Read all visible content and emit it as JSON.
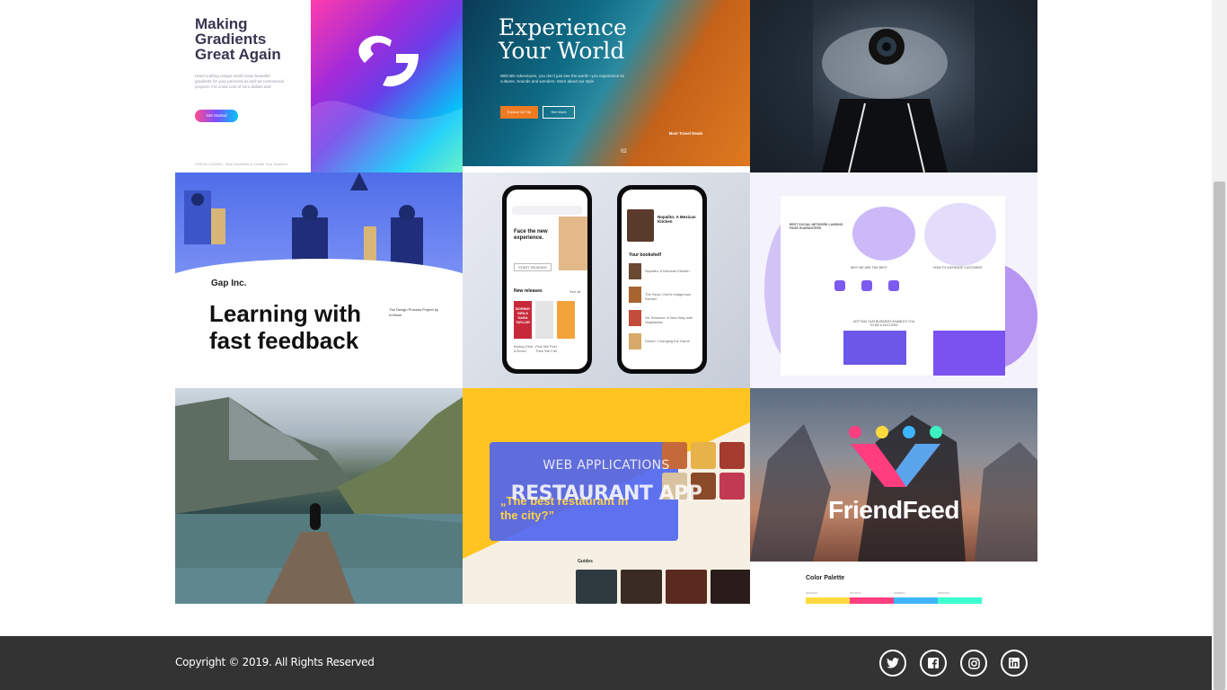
{
  "gallery": {
    "tiles": [
      {
        "title": "Making Gradients Great Again",
        "body": "Hand crafting unique world-class beautiful gradients for your personal as well as commercial projects. For a low cost of zero dollars and",
        "button": "Get Started",
        "footer": "SCROLL DOWN  ↓   New Gradients & Create Your Gradient"
      },
      {
        "title_line1": "Experience",
        "title_line2": "Your World",
        "body": "With BD Adventures, you don't just see the world—you experience its cultures. Sounds and wonders. More about our style",
        "button_primary": "Explore All Trip",
        "button_secondary": "See More",
        "deals_label": "Best Travel Deals",
        "slide_counter": "02"
      },
      {},
      {
        "brand": "Gap Inc.",
        "headline": "Learning with fast feedback",
        "project_label": "The Design Process Project by InVision"
      },
      {
        "left_heading": "Face the new experience.",
        "left_button": "START READING",
        "left_section": "New releases",
        "left_see_all": "See all",
        "book_cover": "BORING GIRLS SARA TAYLOR",
        "book1": "Boring Girls: A Novel",
        "book2": "First We Feel Then We Fall",
        "right_heading": "Nopalito: A Mexican Kitchen",
        "right_section": "Your bookshelf",
        "right_item1": "Nopalito: A Mexican Kitchen",
        "right_item2": "The Sioux Chef's Indigenous Kitchen",
        "right_item3": "Six Seasons: A New Way with Vegetables",
        "right_item4": "Dinner: Changing the Game"
      },
      {
        "headline": "BEST SOCIAL NETWORK LANDING PAGE GUARANTEED",
        "section1": "WHY WE ARE THE BEST",
        "section2": "HOW TO INCREASE CUSTOMER",
        "section3": "GETTING OUR BUSINESS ENABLES YOU TO BE A SUCCESS"
      },
      {},
      {
        "subtitle": "WEB APPLICATIONS",
        "title": "RESTAURANT APP",
        "quote": "„The best restaurant in the city?”",
        "section": "Guides"
      },
      {
        "brand": "FriendFeed",
        "palette_title": "Color Palette",
        "colors": [
          "#FFD93D",
          "#FF3D7F",
          "#3DB6FF",
          "#3DFFD0"
        ],
        "dots": [
          "#FF3D7F",
          "#FFD93D",
          "#3DB6FF",
          "#3DF0C0"
        ]
      }
    ]
  },
  "footer": {
    "copyright": "Copyright © 2019. All Rights Reserved",
    "socials": [
      "twitter-icon",
      "facebook-icon",
      "instagram-icon",
      "linkedin-icon"
    ]
  }
}
